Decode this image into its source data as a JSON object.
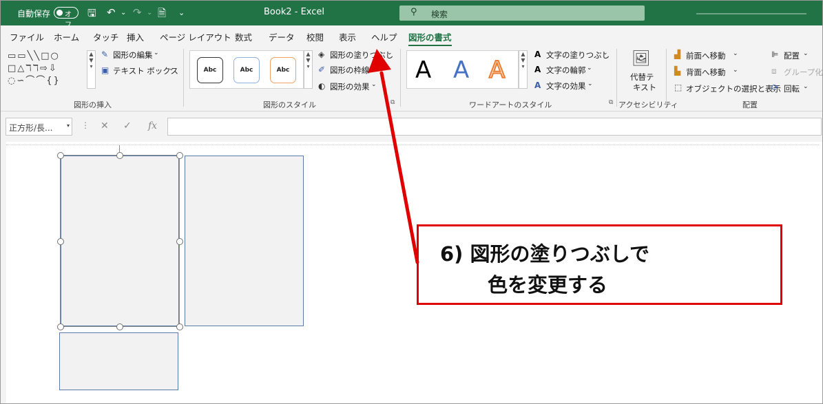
{
  "titlebar": {
    "autosave_label": "自動保存",
    "autosave_state": "オフ",
    "document_title": "Book2  -  Excel",
    "search_placeholder": "検索"
  },
  "tabs": [
    {
      "label": "ファイル"
    },
    {
      "label": "ホーム"
    },
    {
      "label": "タッチ"
    },
    {
      "label": "挿入"
    },
    {
      "label": "ページ レイアウト"
    },
    {
      "label": "数式"
    },
    {
      "label": "データ"
    },
    {
      "label": "校閲"
    },
    {
      "label": "表示"
    },
    {
      "label": "ヘルプ"
    },
    {
      "label": "図形の書式",
      "active": true
    }
  ],
  "ribbon": {
    "insert_shapes": {
      "edit_shape": "図形の編集",
      "text_box": "テキスト ボックス",
      "group_label": "図形の挿入"
    },
    "shape_styles": {
      "style_sample": "Abc",
      "shape_fill": "図形の塗りつぶし",
      "shape_outline": "図形の枠線",
      "shape_effects": "図形の効果",
      "group_label": "図形のスタイル"
    },
    "wordart": {
      "sample": "A",
      "text_fill": "文字の塗りつぶし",
      "text_outline": "文字の輪郭",
      "text_effects": "文字の効果",
      "group_label": "ワードアートのスタイル"
    },
    "accessibility": {
      "alt_text_line1": "代替テ",
      "alt_text_line2": "キスト",
      "group_label": "アクセシビリティ"
    },
    "arrange": {
      "bring_forward": "前面へ移動",
      "send_backward": "背面へ移動",
      "selection_pane": "オブジェクトの選択と表示",
      "align": "配置",
      "group": "グループ化",
      "rotate": "回転",
      "group_label": "配置"
    }
  },
  "formula_bar": {
    "name_box": "正方形/長...",
    "fx": "fx"
  },
  "callout": {
    "line1": "6) 図形の塗りつぶしで",
    "line2": "色を変更する"
  },
  "colors": {
    "title_bar": "#217346",
    "accent": "#217346",
    "callout_border": "#e00000",
    "arrow": "#e00000",
    "shape_fill": "#f2f2f2",
    "shape_outline": "#5979a6"
  }
}
